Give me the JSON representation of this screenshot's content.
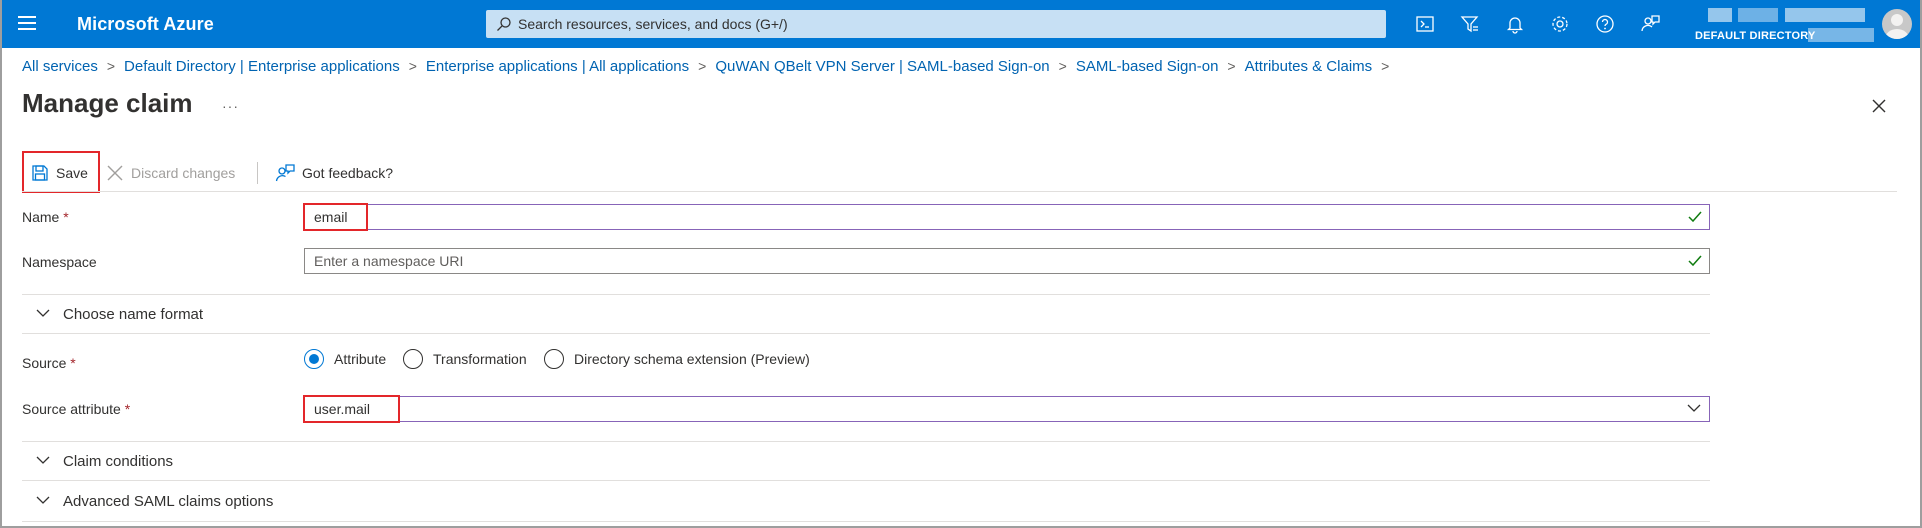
{
  "topbar": {
    "brand": "Microsoft Azure",
    "search_placeholder": "Search resources, services, and docs (G+/)",
    "directory_label": "DEFAULT DIRECTORY",
    "icons": [
      "cloud-shell-icon",
      "directory-filter-icon",
      "notifications-icon",
      "settings-icon",
      "help-icon",
      "feedback-icon"
    ]
  },
  "breadcrumb": [
    "All services",
    "Default Directory | Enterprise applications",
    "Enterprise applications | All applications",
    "QuWAN QBelt VPN Server | SAML-based Sign-on",
    "SAML-based Sign-on",
    "Attributes & Claims"
  ],
  "page": {
    "title": "Manage claim",
    "more": "···"
  },
  "toolbar": {
    "save_label": "Save",
    "discard_label": "Discard changes",
    "feedback_label": "Got feedback?"
  },
  "form": {
    "name_label": "Name",
    "name_value": "email",
    "namespace_label": "Namespace",
    "namespace_placeholder": "Enter a namespace URI",
    "required_mark": "*",
    "name_format_section": "Choose name format",
    "source_label": "Source",
    "source_options": [
      "Attribute",
      "Transformation",
      "Directory schema extension (Preview)"
    ],
    "source_selected": "Attribute",
    "source_attribute_label": "Source attribute",
    "source_attribute_value": "user.mail",
    "claim_conditions_section": "Claim conditions",
    "advanced_section": "Advanced SAML claims options"
  },
  "colors": {
    "header_bg": "#0078d4",
    "link": "#0063b1",
    "highlight": "#e3262a",
    "focus_border": "#8764b8",
    "valid_check": "#107c10"
  }
}
